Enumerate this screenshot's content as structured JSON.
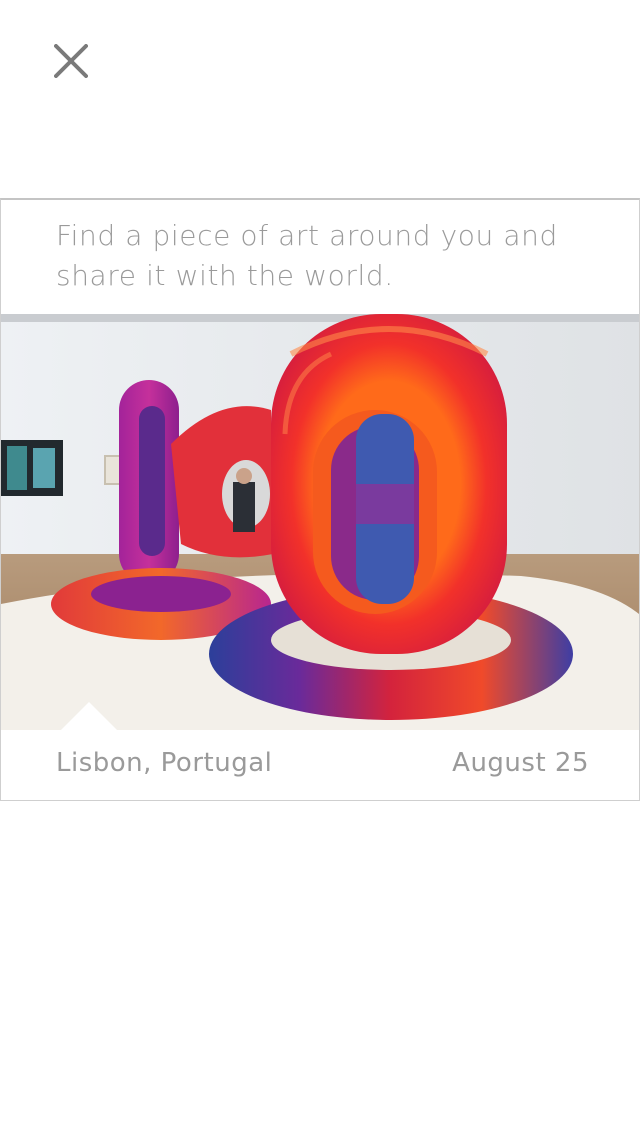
{
  "header": {
    "close_icon": "close-icon"
  },
  "card": {
    "prompt": "Find a piece of art around you and share it with the world.",
    "photo_icon": "artwork-photo",
    "location": "Lisbon, Portugal",
    "date": "August 25"
  },
  "colors": {
    "background": "#ffffff",
    "text": "#9a9a9a",
    "icon": "#7a7a7a",
    "border": "#cfcfcf"
  }
}
